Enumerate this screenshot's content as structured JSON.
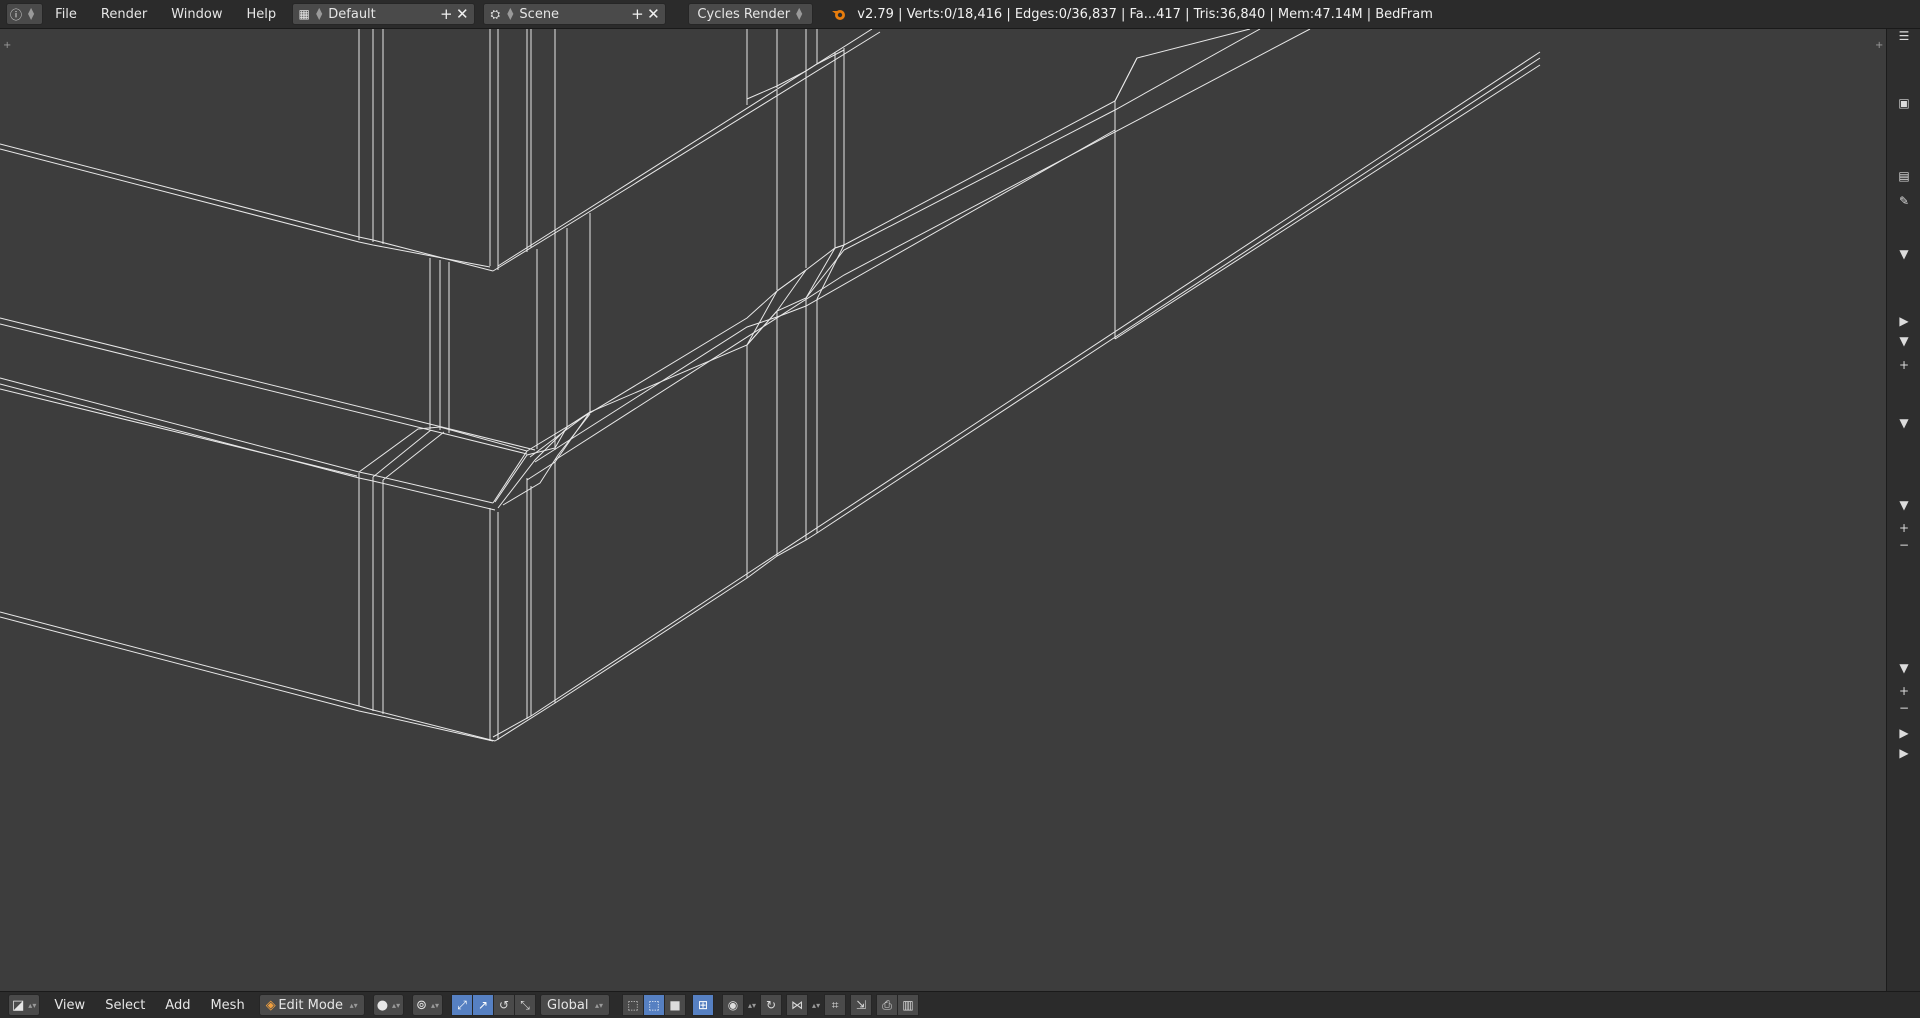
{
  "menubar": {
    "info_icon": "info-icon",
    "menus": [
      "File",
      "Render",
      "Window",
      "Help"
    ],
    "screen_layout": {
      "icon": "layout-icon",
      "name": "Default"
    },
    "scene": {
      "icon": "scene-icon",
      "name": "Scene"
    },
    "render_engine": "Cycles Render",
    "stats": "v2.79 | Verts:0/18,416 | Edges:0/36,837 | Fa...417 | Tris:36,840 | Mem:47.14M | BedFram"
  },
  "viewport_header": {
    "menus": [
      "View",
      "Select",
      "Add",
      "Mesh"
    ],
    "mode": "Edit Mode",
    "transform_orientation": "Global"
  },
  "colors": {
    "viewport_bg": "#3d3d3d",
    "header_bg": "#2b2b2b",
    "wire": "#e8e8e8",
    "active_button": "#5680c2"
  }
}
